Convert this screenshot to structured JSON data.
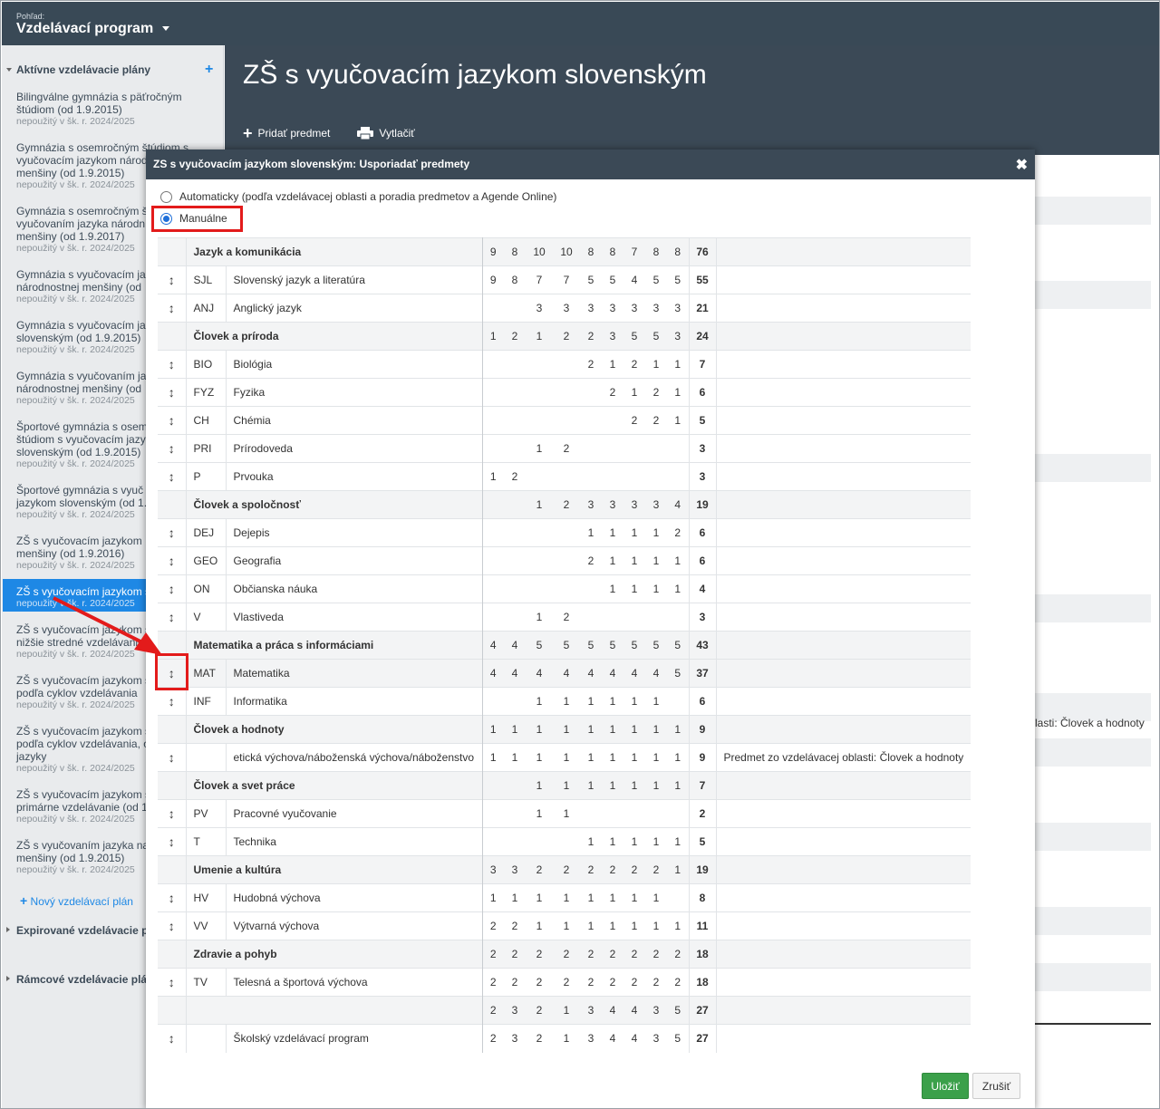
{
  "topbar": {
    "view_label": "Pohľad:",
    "view_title": "Vzdelávací program"
  },
  "sidebar": {
    "active_section": "Aktívne vzdelávacie plány",
    "items": [
      {
        "title": "Bilingválne gymnázia s päťročným\nštúdiom (od 1.9.2015)",
        "status": "nepoužitý v šk. r. 2024/2025"
      },
      {
        "title": "Gymnázia s osemročným štúdiom s\nvyučovacím jazykom národ\nmenšiny (od 1.9.2015)",
        "status": "nepoužitý v šk. r. 2024/2025"
      },
      {
        "title": "Gymnázia s osemročným š\nvyučovaním jazyka národn\nmenšiny (od 1.9.2017)",
        "status": "nepoužitý v šk. r. 2024/2025"
      },
      {
        "title": "Gymnázia s vyučovacím ja\nnárodnostnej menšiny (od",
        "status": "nepoužitý v šk. r. 2024/2025"
      },
      {
        "title": "Gymnázia s vyučovacím ja\nslovenským (od 1.9.2015)",
        "status": "nepoužitý v šk. r. 2024/2025"
      },
      {
        "title": "Gymnázia s vyučovaním ja\nnárodnostnej menšiny (od",
        "status": "nepoužitý v šk. r. 2024/2025"
      },
      {
        "title": "Športové gymnázia s osem\nštúdiom s vyučovacím jazy\nslovenským (od 1.9.2015)",
        "status": "nepoužitý v šk. r. 2024/2025"
      },
      {
        "title": "Športové gymnázia s vyuč\njazykom slovenským (od 1.",
        "status": "nepoužitý v šk. r. 2024/2025"
      },
      {
        "title": "ZŠ s vyučovacím jazykom\nmenšiny (od 1.9.2016)",
        "status": "nepoužitý v šk. r. 2024/2025"
      },
      {
        "title": "ZŠ s vyučovacím jazykom s",
        "status": "nepoužitý v šk. r. 2024/2025"
      },
      {
        "title": "ZŠ s vyučovacím jazykom s\nnižšie stredné vzdelávanie",
        "status": "nepoužitý v šk. r. 2024/2025"
      },
      {
        "title": "ZŠ s vyučovacím jazykom s\npodľa cyklov vzdelávania",
        "status": "nepoužitý v šk. r. 2024/2025"
      },
      {
        "title": "ZŠ s vyučovacím jazykom s\npodľa cyklov vzdelávania, o\njazyky",
        "status": "nepoužitý v šk. r. 2024/2025"
      },
      {
        "title": "ZŠ s vyučovacím jazykom s\nprimárne vzdelávanie (od 1",
        "status": "nepoužitý v šk. r. 2024/2025"
      },
      {
        "title": "ZŠ s vyučovaním jazyka na\nmenšiny (od 1.9.2015)",
        "status": "nepoužitý v šk. r. 2024/2025"
      }
    ],
    "new_plan": "Nový vzdelávací plán",
    "expired_section": "Expirované vzdelávacie p",
    "framework_section": "Rámcové vzdelávacie plá"
  },
  "page": {
    "title": "ZŠ s vyučovacím jazykom slovenským",
    "add_subject": "Pridať predmet",
    "print": "Vytlačiť"
  },
  "background": {
    "note_fragment": "lasti: Človek a hodnoty"
  },
  "dialog": {
    "title": "ZS s vyučovacím jazykom slovenským: Usporiadať predmety",
    "option_auto": "Automaticky (podľa vzdelávacej oblasti a poradia predmetov a Agende Online)",
    "option_manual": "Manuálne",
    "save": "Uložiť",
    "cancel": "Zrušiť",
    "rows": [
      {
        "type": "area",
        "name": "Jazyk a komunikácia",
        "vals": [
          "9",
          "8",
          "10",
          "10",
          "8",
          "8",
          "7",
          "8",
          "8"
        ],
        "sum": "76"
      },
      {
        "type": "subj",
        "code": "SJL",
        "name": "Slovenský jazyk a literatúra",
        "vals": [
          "9",
          "8",
          "7",
          "7",
          "5",
          "5",
          "4",
          "5",
          "5"
        ],
        "sum": "55"
      },
      {
        "type": "subj",
        "code": "ANJ",
        "name": "Anglický jazyk",
        "vals": [
          "",
          "",
          "3",
          "3",
          "3",
          "3",
          "3",
          "3",
          "3"
        ],
        "sum": "21"
      },
      {
        "type": "area",
        "name": "Človek a príroda",
        "vals": [
          "1",
          "2",
          "1",
          "2",
          "2",
          "3",
          "5",
          "5",
          "3"
        ],
        "sum": "24"
      },
      {
        "type": "subj",
        "code": "BIO",
        "name": "Biológia",
        "vals": [
          "",
          "",
          "",
          "",
          "2",
          "1",
          "2",
          "1",
          "1"
        ],
        "sum": "7"
      },
      {
        "type": "subj",
        "code": "FYZ",
        "name": "Fyzika",
        "vals": [
          "",
          "",
          "",
          "",
          "",
          "2",
          "1",
          "2",
          "1"
        ],
        "sum": "6"
      },
      {
        "type": "subj",
        "code": "CH",
        "name": "Chémia",
        "vals": [
          "",
          "",
          "",
          "",
          "",
          "",
          "2",
          "2",
          "1"
        ],
        "sum": "5"
      },
      {
        "type": "subj",
        "code": "PRI",
        "name": "Prírodoveda",
        "vals": [
          "",
          "",
          "1",
          "2",
          "",
          "",
          "",
          "",
          ""
        ],
        "sum": "3"
      },
      {
        "type": "subj",
        "code": "P",
        "name": "Prvouka",
        "vals": [
          "1",
          "2",
          "",
          "",
          "",
          "",
          "",
          "",
          ""
        ],
        "sum": "3"
      },
      {
        "type": "area",
        "name": "Človek a spoločnosť",
        "vals": [
          "",
          "",
          "1",
          "2",
          "3",
          "3",
          "3",
          "3",
          "4"
        ],
        "sum": "19"
      },
      {
        "type": "subj",
        "code": "DEJ",
        "name": "Dejepis",
        "vals": [
          "",
          "",
          "",
          "",
          "1",
          "1",
          "1",
          "1",
          "2"
        ],
        "sum": "6"
      },
      {
        "type": "subj",
        "code": "GEO",
        "name": "Geografia",
        "vals": [
          "",
          "",
          "",
          "",
          "2",
          "1",
          "1",
          "1",
          "1"
        ],
        "sum": "6"
      },
      {
        "type": "subj",
        "code": "ON",
        "name": "Občianska náuka",
        "vals": [
          "",
          "",
          "",
          "",
          "",
          "1",
          "1",
          "1",
          "1"
        ],
        "sum": "4"
      },
      {
        "type": "subj",
        "code": "V",
        "name": "Vlastiveda",
        "vals": [
          "",
          "",
          "1",
          "2",
          "",
          "",
          "",
          "",
          ""
        ],
        "sum": "3"
      },
      {
        "type": "area",
        "name": "Matematika a práca s informáciami",
        "vals": [
          "4",
          "4",
          "5",
          "5",
          "5",
          "5",
          "5",
          "5",
          "5"
        ],
        "sum": "43"
      },
      {
        "type": "subj",
        "code": "MAT",
        "name": "Matematika",
        "vals": [
          "4",
          "4",
          "4",
          "4",
          "4",
          "4",
          "4",
          "4",
          "5"
        ],
        "sum": "37",
        "hover": true
      },
      {
        "type": "subj",
        "code": "INF",
        "name": "Informatika",
        "vals": [
          "",
          "",
          "1",
          "1",
          "1",
          "1",
          "1",
          "1",
          ""
        ],
        "sum": "6"
      },
      {
        "type": "area",
        "name": "Človek a hodnoty",
        "vals": [
          "1",
          "1",
          "1",
          "1",
          "1",
          "1",
          "1",
          "1",
          "1"
        ],
        "sum": "9"
      },
      {
        "type": "subj",
        "code": "",
        "name": "etická výchova/náboženská výchova/náboženstvo",
        "vals": [
          "1",
          "1",
          "1",
          "1",
          "1",
          "1",
          "1",
          "1",
          "1"
        ],
        "sum": "9",
        "note": "Predmet zo vzdelávacej oblasti: Človek a hodnoty"
      },
      {
        "type": "area",
        "name": "Človek a svet práce",
        "vals": [
          "",
          "",
          "1",
          "1",
          "1",
          "1",
          "1",
          "1",
          "1"
        ],
        "sum": "7"
      },
      {
        "type": "subj",
        "code": "PV",
        "name": "Pracovné vyučovanie",
        "vals": [
          "",
          "",
          "1",
          "1",
          "",
          "",
          "",
          "",
          ""
        ],
        "sum": "2"
      },
      {
        "type": "subj",
        "code": "T",
        "name": "Technika",
        "vals": [
          "",
          "",
          "",
          "",
          "1",
          "1",
          "1",
          "1",
          "1"
        ],
        "sum": "5"
      },
      {
        "type": "area",
        "name": "Umenie a kultúra",
        "vals": [
          "3",
          "3",
          "2",
          "2",
          "2",
          "2",
          "2",
          "2",
          "1"
        ],
        "sum": "19"
      },
      {
        "type": "subj",
        "code": "HV",
        "name": "Hudobná výchova",
        "vals": [
          "1",
          "1",
          "1",
          "1",
          "1",
          "1",
          "1",
          "1",
          ""
        ],
        "sum": "8"
      },
      {
        "type": "subj",
        "code": "VV",
        "name": "Výtvarná výchova",
        "vals": [
          "2",
          "2",
          "1",
          "1",
          "1",
          "1",
          "1",
          "1",
          "1"
        ],
        "sum": "11"
      },
      {
        "type": "area",
        "name": "Zdravie a pohyb",
        "vals": [
          "2",
          "2",
          "2",
          "2",
          "2",
          "2",
          "2",
          "2",
          "2"
        ],
        "sum": "18"
      },
      {
        "type": "subj",
        "code": "TV",
        "name": "Telesná a športová výchova",
        "vals": [
          "2",
          "2",
          "2",
          "2",
          "2",
          "2",
          "2",
          "2",
          "2"
        ],
        "sum": "18"
      },
      {
        "type": "area",
        "name": "",
        "vals": [
          "2",
          "3",
          "2",
          "1",
          "3",
          "4",
          "4",
          "3",
          "5"
        ],
        "sum": "27"
      },
      {
        "type": "subj",
        "code": "",
        "name": "Školský vzdelávací program",
        "vals": [
          "2",
          "3",
          "2",
          "1",
          "3",
          "4",
          "4",
          "3",
          "5"
        ],
        "sum": "27"
      }
    ]
  },
  "colors": {
    "accent": "#1e88e5",
    "header": "#3b4956",
    "highlight": "#e31b1b",
    "save": "#3ba04a"
  }
}
